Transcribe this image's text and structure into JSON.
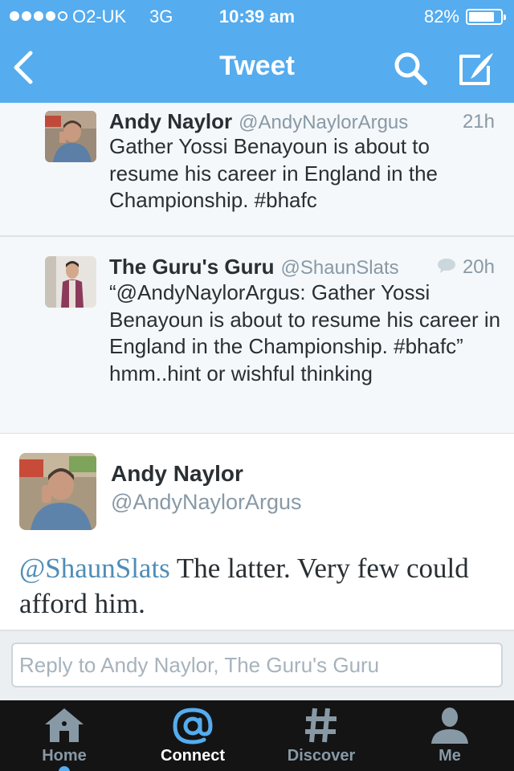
{
  "status_bar": {
    "carrier": "O2-UK",
    "network": "3G",
    "time": "10:39 am",
    "battery_percent": "82%",
    "battery_level": 0.82,
    "signal_bars_filled": 4,
    "signal_bars_total": 5
  },
  "nav": {
    "title": "Tweet",
    "back_icon": "chevron-left-icon",
    "search_icon": "search-icon",
    "compose_icon": "compose-icon"
  },
  "tweets": [
    {
      "name": "Andy Naylor",
      "handle": "@AndyNaylorArgus",
      "time": "21h",
      "text": "Gather Yossi Benayoun is about to resume his career in England in the Championship. #bhafc"
    },
    {
      "name": "The Guru's Guru",
      "handle": "@ShaunSlats",
      "time": "20h",
      "text": "“@AndyNaylorArgus: Gather Yossi Benayoun is about to resume his career in England in the Championship. #bhafc” hmm..hint or wishful thinking"
    }
  ],
  "main_tweet": {
    "name": "Andy Naylor",
    "handle": "@AndyNaylorArgus",
    "mention": "@ShaunSlats",
    "text": " The latter. Very few could afford him."
  },
  "reply": {
    "placeholder": "Reply to Andy Naylor, The Guru's Guru"
  },
  "tabs": [
    {
      "label": "Home",
      "icon": "home-icon"
    },
    {
      "label": "Connect",
      "icon": "at-icon",
      "active": true
    },
    {
      "label": "Discover",
      "icon": "hashtag-icon"
    },
    {
      "label": "Me",
      "icon": "person-icon"
    }
  ],
  "colors": {
    "brand_blue": "#55acee",
    "tab_bar": "#141414",
    "mention": "#4f8db8",
    "muted": "#8899a6"
  }
}
